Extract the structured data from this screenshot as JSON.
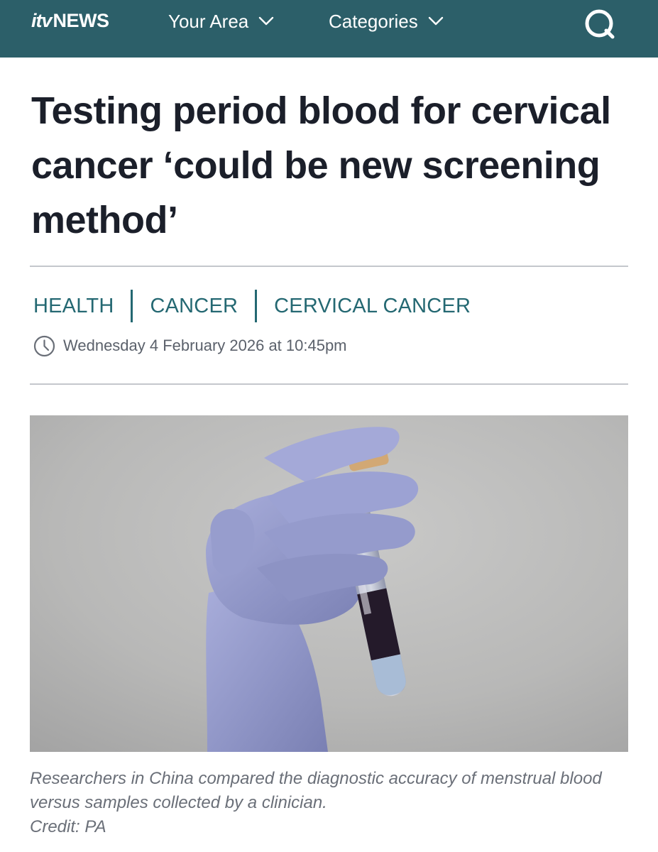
{
  "header": {
    "logo_itv": "itv",
    "logo_news": "NEWS",
    "nav": [
      {
        "label": "Your Area"
      },
      {
        "label": "Categories"
      }
    ],
    "search_icon": "search-icon"
  },
  "article": {
    "headline": "Testing period blood for cervical cancer ‘could be new screening method’",
    "tags": [
      "HEALTH",
      "CANCER",
      "CERVICAL CANCER"
    ],
    "date": "Wednesday 4 February 2026 at 10:45pm",
    "image_caption": "Researchers in China compared the diagnostic accuracy of menstrual blood versus samples collected by a clinician.",
    "image_credit": "Credit: PA"
  },
  "colors": {
    "header_bg": "#2c5f69",
    "accent": "#246872",
    "text": "#1b1f2a",
    "muted": "#5b616b"
  }
}
